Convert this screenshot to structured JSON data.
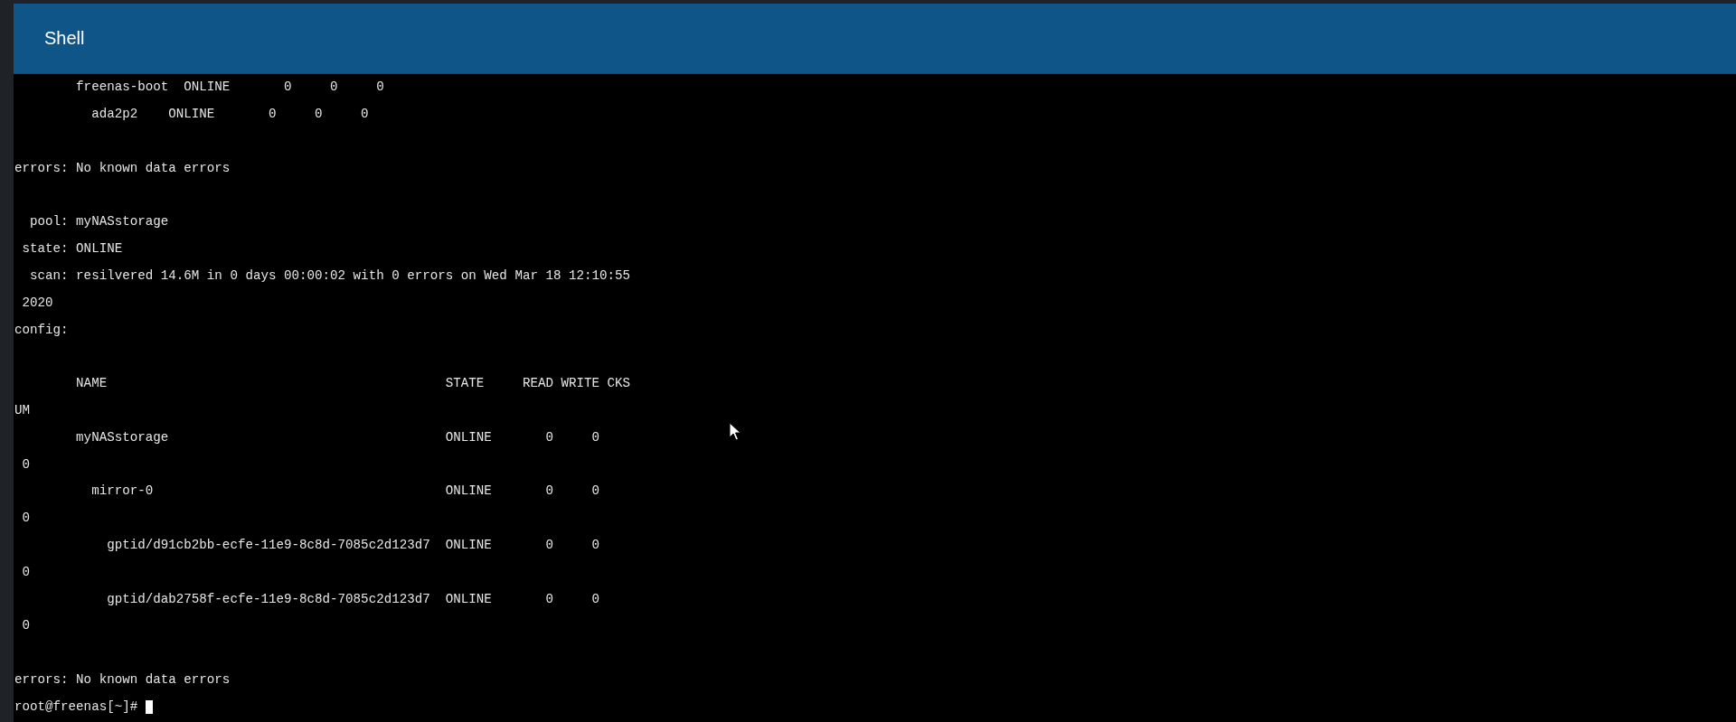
{
  "header": {
    "title": "Shell"
  },
  "terminal": {
    "lines": [
      {
        "kind": "text",
        "text": "        freenas-boot  ONLINE       0     0     0"
      },
      {
        "kind": "text",
        "text": "          ada2p2    ONLINE       0     0     0"
      },
      {
        "kind": "blank"
      },
      {
        "kind": "text",
        "text": "errors: No known data errors"
      },
      {
        "kind": "blank"
      },
      {
        "kind": "text",
        "text": "  pool: myNASstorage"
      },
      {
        "kind": "text",
        "text": " state: ONLINE"
      },
      {
        "kind": "text",
        "text": "  scan: resilvered 14.6M in 0 days 00:00:02 with 0 errors on Wed Mar 18 12:10:55"
      },
      {
        "kind": "text",
        "text": " 2020"
      },
      {
        "kind": "text",
        "text": "config:"
      },
      {
        "kind": "blank"
      },
      {
        "kind": "text",
        "text": "        NAME                                            STATE     READ WRITE CKS"
      },
      {
        "kind": "text",
        "text": "UM"
      },
      {
        "kind": "text",
        "text": "        myNASstorage                                    ONLINE       0     0"
      },
      {
        "kind": "text",
        "text": " 0"
      },
      {
        "kind": "text",
        "text": "          mirror-0                                      ONLINE       0     0"
      },
      {
        "kind": "text",
        "text": " 0"
      },
      {
        "kind": "text",
        "text": "            gptid/d91cb2bb-ecfe-11e9-8c8d-7085c2d123d7  ONLINE       0     0"
      },
      {
        "kind": "text",
        "text": " 0"
      },
      {
        "kind": "text",
        "text": "            gptid/dab2758f-ecfe-11e9-8c8d-7085c2d123d7  ONLINE       0     0"
      },
      {
        "kind": "text",
        "text": " 0"
      },
      {
        "kind": "blank"
      },
      {
        "kind": "text",
        "text": "errors: No known data errors"
      },
      {
        "kind": "prompt",
        "text": "root@freenas[~]# ",
        "cursor": true
      }
    ]
  }
}
